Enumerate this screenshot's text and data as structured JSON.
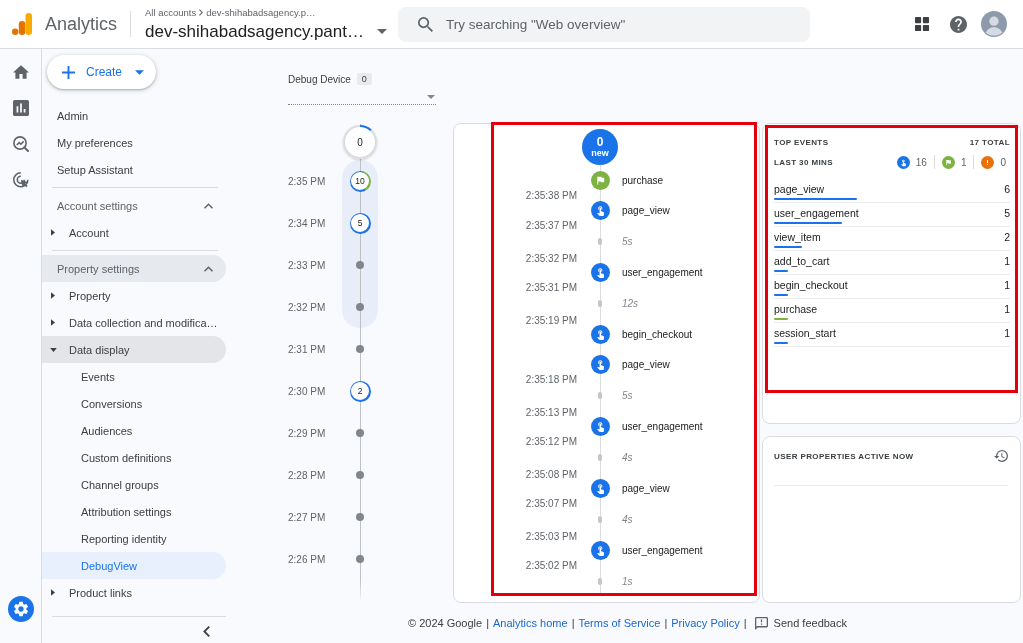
{
  "app_bar": {
    "product": "Analytics",
    "breadcrumb": [
      "All accounts",
      "dev-shihabadsagency.p…"
    ],
    "account": "dev-shihabadsagency.pant…",
    "search": {
      "placeholder": "Try searching \"Web overview\""
    }
  },
  "sidebar": {
    "create_button": "Create",
    "links": [
      {
        "label": "Admin",
        "selected": false
      },
      {
        "label": "My preferences",
        "selected": false
      },
      {
        "label": "Setup Assistant",
        "selected": false
      }
    ],
    "sections": [
      {
        "title": "Account settings",
        "expanded": true,
        "active": false,
        "items": [
          {
            "label": "Account",
            "expanded": false,
            "active": false
          }
        ]
      },
      {
        "title": "Property settings",
        "expanded": true,
        "active": true,
        "items": [
          {
            "label": "Property",
            "expanded": false,
            "active": false
          },
          {
            "label": "Data collection and modifica…",
            "expanded": false,
            "active": false
          },
          {
            "label": "Data display",
            "expanded": true,
            "active": true,
            "children": [
              {
                "label": "Events",
                "selected": false
              },
              {
                "label": "Conversions",
                "selected": false
              },
              {
                "label": "Audiences",
                "selected": false
              },
              {
                "label": "Custom definitions",
                "selected": false
              },
              {
                "label": "Channel groups",
                "selected": false
              },
              {
                "label": "Attribution settings",
                "selected": false
              },
              {
                "label": "Reporting identity",
                "selected": false
              },
              {
                "label": "DebugView",
                "selected": true
              }
            ]
          },
          {
            "label": "Product links",
            "expanded": false,
            "active": false
          }
        ]
      }
    ]
  },
  "debug_device": {
    "label": "Debug Device",
    "count": "0"
  },
  "minute_timeline": {
    "countdown": {
      "count": "0",
      "level": 0.12
    },
    "minutes": [
      {
        "time": "2:35 PM",
        "count": "10",
        "has_conversion": true,
        "in_view": true
      },
      {
        "time": "2:34 PM",
        "count": "5",
        "has_conversion": false,
        "in_view": true
      },
      {
        "time": "2:33 PM",
        "in_view": true
      },
      {
        "time": "2:32 PM",
        "in_view": true
      },
      {
        "time": "2:31 PM",
        "in_view": false
      },
      {
        "time": "2:30 PM",
        "count": "2",
        "has_conversion": false,
        "in_view": false
      },
      {
        "time": "2:29 PM",
        "in_view": false
      },
      {
        "time": "2:28 PM",
        "in_view": false
      },
      {
        "time": "2:27 PM",
        "in_view": false
      },
      {
        "time": "2:26 PM",
        "in_view": false
      }
    ]
  },
  "event_stream": {
    "new_count": "0",
    "new_label": "new",
    "items": [
      {
        "kind": "conversion",
        "name": "purchase",
        "time": "2:35:38 PM"
      },
      {
        "kind": "event",
        "name": "page_view",
        "time": "2:35:37 PM"
      },
      {
        "kind": "gap",
        "duration": "5s",
        "time": "2:35:32 PM"
      },
      {
        "kind": "event",
        "name": "user_engagement",
        "time": "2:35:31 PM"
      },
      {
        "kind": "gap",
        "duration": "12s",
        "time": "2:35:19 PM"
      },
      {
        "kind": "event",
        "name": "begin_checkout"
      },
      {
        "kind": "event",
        "name": "page_view",
        "time": "2:35:18 PM"
      },
      {
        "kind": "gap",
        "duration": "5s",
        "time": "2:35:13 PM"
      },
      {
        "kind": "event",
        "name": "user_engagement",
        "time": "2:35:12 PM"
      },
      {
        "kind": "gap",
        "duration": "4s",
        "time": "2:35:08 PM"
      },
      {
        "kind": "event",
        "name": "page_view",
        "time": "2:35:07 PM"
      },
      {
        "kind": "gap",
        "duration": "4s",
        "time": "2:35:03 PM"
      },
      {
        "kind": "event",
        "name": "user_engagement",
        "time": "2:35:02 PM"
      },
      {
        "kind": "gap",
        "duration": "1s"
      }
    ]
  },
  "top_events": {
    "title": "TOP EVENTS",
    "total": "17 TOTAL",
    "period": "LAST 30 MINS",
    "counts": [
      {
        "kind": "event",
        "value": "16"
      },
      {
        "kind": "conversion",
        "value": "1"
      },
      {
        "kind": "error",
        "value": "0"
      }
    ],
    "rows": [
      {
        "name": "page_view",
        "count": "6",
        "kind": "event",
        "level": 0.35
      },
      {
        "name": "user_engagement",
        "count": "5",
        "kind": "event",
        "level": 0.29
      },
      {
        "name": "view_item",
        "count": "2",
        "kind": "event",
        "level": 0.12
      },
      {
        "name": "add_to_cart",
        "count": "1",
        "kind": "event",
        "level": 0.06
      },
      {
        "name": "begin_checkout",
        "count": "1",
        "kind": "event",
        "level": 0.06
      },
      {
        "name": "purchase",
        "count": "1",
        "kind": "conversion",
        "level": 0.06
      },
      {
        "name": "session_start",
        "count": "1",
        "kind": "event",
        "level": 0.06
      }
    ]
  },
  "user_properties": {
    "title": "USER PROPERTIES ACTIVE NOW"
  },
  "footer": {
    "copyright": "© 2024 Google",
    "separator": "|",
    "links": [
      "Analytics home",
      "Terms of Service",
      "Privacy Policy"
    ],
    "feedback": "Send feedback"
  }
}
